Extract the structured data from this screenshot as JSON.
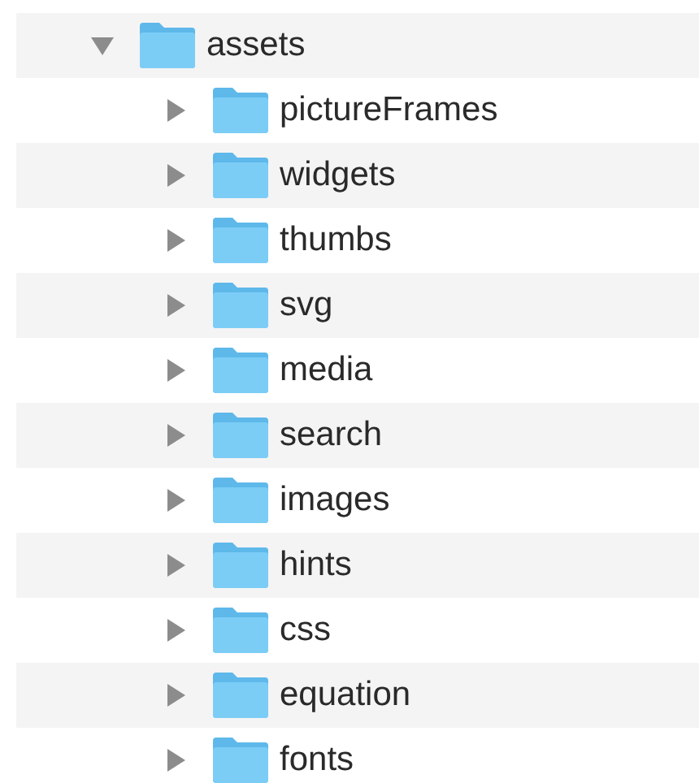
{
  "tree": [
    {
      "name": "assets",
      "expanded": true,
      "children": [
        {
          "name": "pictureFrames",
          "expanded": false
        },
        {
          "name": "widgets",
          "expanded": false
        },
        {
          "name": "thumbs",
          "expanded": false
        },
        {
          "name": "svg",
          "expanded": false
        },
        {
          "name": "media",
          "expanded": false
        },
        {
          "name": "search",
          "expanded": false
        },
        {
          "name": "images",
          "expanded": false
        },
        {
          "name": "hints",
          "expanded": false
        },
        {
          "name": "css",
          "expanded": false
        },
        {
          "name": "equation",
          "expanded": false
        },
        {
          "name": "fonts",
          "expanded": false
        }
      ]
    }
  ]
}
